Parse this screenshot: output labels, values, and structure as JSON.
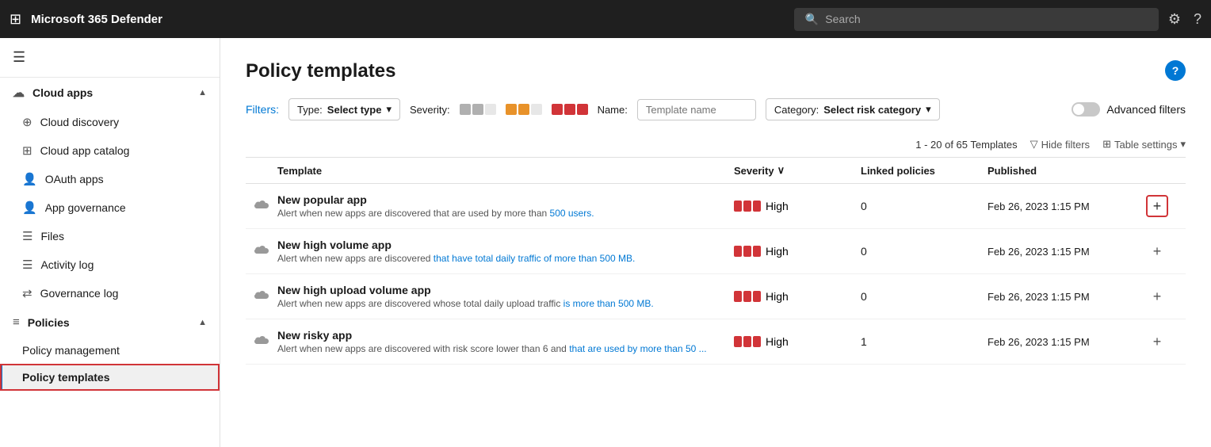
{
  "topbar": {
    "title": "Microsoft 365 Defender",
    "search_placeholder": "Search"
  },
  "sidebar": {
    "menu_icon": "☰",
    "cloud_apps_label": "Cloud apps",
    "items": [
      {
        "id": "cloud-discovery",
        "label": "Cloud discovery",
        "icon": "⊕"
      },
      {
        "id": "cloud-app-catalog",
        "label": "Cloud app catalog",
        "icon": "⊞"
      },
      {
        "id": "oauth-apps",
        "label": "OAuth apps",
        "icon": "👤"
      },
      {
        "id": "app-governance",
        "label": "App governance",
        "icon": "👤"
      },
      {
        "id": "files",
        "label": "Files",
        "icon": "☰"
      },
      {
        "id": "activity-log",
        "label": "Activity log",
        "icon": "☰"
      },
      {
        "id": "governance-log",
        "label": "Governance log",
        "icon": "⇄"
      },
      {
        "id": "policies",
        "label": "Policies",
        "icon": "≡"
      },
      {
        "id": "policy-management",
        "label": "Policy management",
        "icon": ""
      },
      {
        "id": "policy-templates",
        "label": "Policy templates",
        "icon": "",
        "active": true
      }
    ]
  },
  "main": {
    "title": "Policy templates",
    "filters_label": "Filters:",
    "type_filter": "Type:",
    "type_filter_value": "Select type",
    "severity_filter": "Severity:",
    "name_filter": "Name:",
    "name_placeholder": "Template name",
    "category_filter": "Category:",
    "category_filter_value": "Select risk category",
    "advanced_filters_label": "Advanced filters",
    "table_count": "1 - 20 of 65 Templates",
    "hide_filters": "Hide filters",
    "table_settings": "Table settings",
    "columns": {
      "template": "Template",
      "severity": "Severity",
      "linked_policies": "Linked policies",
      "published": "Published"
    },
    "rows": [
      {
        "name": "New popular app",
        "desc_prefix": "Alert when new apps are discovered that are used by more than ",
        "desc_link": "500 users.",
        "desc_suffix": "",
        "severity": "High",
        "linked": "0",
        "published": "Feb 26, 2023 1:15 PM",
        "add_highlight": true
      },
      {
        "name": "New high volume app",
        "desc_prefix": "Alert when new apps are discovered ",
        "desc_link": "that have total daily traffic of more than 500 MB.",
        "desc_suffix": "",
        "severity": "High",
        "linked": "0",
        "published": "Feb 26, 2023 1:15 PM",
        "add_highlight": false
      },
      {
        "name": "New high upload volume app",
        "desc_prefix": "Alert when new apps are discovered whose total daily upload traffic ",
        "desc_link": "is more than 500 MB.",
        "desc_suffix": "",
        "severity": "High",
        "linked": "0",
        "published": "Feb 26, 2023 1:15 PM",
        "add_highlight": false
      },
      {
        "name": "New risky app",
        "desc_prefix": "Alert when new apps are discovered with risk score lower than 6 and ",
        "desc_link": "that are used by more than 50 ...",
        "desc_suffix": "",
        "severity": "High",
        "linked": "1",
        "published": "Feb 26, 2023 1:15 PM",
        "add_highlight": false
      }
    ]
  }
}
